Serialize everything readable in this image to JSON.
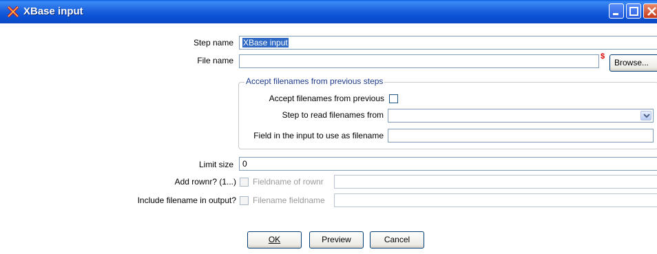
{
  "window": {
    "title": "XBase input",
    "app_icon": "kettle-x-icon"
  },
  "fields": {
    "step_name": {
      "label": "Step name",
      "value": "XBase input"
    },
    "file_name": {
      "label": "File name",
      "value": "",
      "browse_label": "Browse..."
    },
    "group": {
      "legend": "Accept filenames from previous steps",
      "accept_label": "Accept filenames from previous",
      "step_label": "Step to read filenames from",
      "step_value": "",
      "field_label": "Field in the input to use as filename",
      "field_value": ""
    },
    "limit_size": {
      "label": "Limit size",
      "value": "0"
    },
    "add_rownr": {
      "label": "Add rownr? (1...)",
      "sub_label": "Fieldname of rownr",
      "value": ""
    },
    "include_filename": {
      "label": "Include filename in output?",
      "sub_label": "Filename fieldname",
      "value": ""
    }
  },
  "buttons": {
    "ok": "OK",
    "preview": "Preview",
    "cancel": "Cancel"
  },
  "colors": {
    "titlebar": "#0a52d6",
    "selection": "#316ac5",
    "required": "#dd0000"
  }
}
